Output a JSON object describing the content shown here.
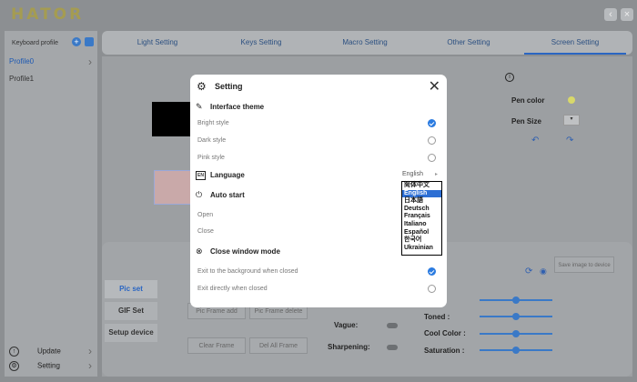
{
  "app": {
    "logo": "HATOR",
    "minimize_label": "‹",
    "close_label": "×"
  },
  "sidebar": {
    "header": "Keyboard profile",
    "add_label": "+",
    "profiles": [
      {
        "label": "Profile0",
        "active": true
      },
      {
        "label": "Profile1",
        "active": false
      }
    ],
    "footer": [
      {
        "label": "Update",
        "icon": "↑"
      },
      {
        "label": "Setting",
        "icon": "⚙"
      }
    ]
  },
  "tabs": [
    {
      "label": "Light Setting",
      "active": false
    },
    {
      "label": "Keys Setting",
      "active": false
    },
    {
      "label": "Macro Setting",
      "active": false
    },
    {
      "label": "Other Setting",
      "active": false
    },
    {
      "label": "Screen Setting",
      "active": true
    }
  ],
  "screen": {
    "pen_color_label": "Pen color",
    "pen_size_label": "Pen Size",
    "pen_color": "#d8d86a",
    "info_label": "i"
  },
  "bottom": {
    "side_tabs": [
      {
        "label": "Pic set",
        "active": true
      },
      {
        "label": "GIF Set",
        "active": false
      },
      {
        "label": "Setup device",
        "active": false
      }
    ],
    "buttons": {
      "pic_frame_add": "Pic Frame add",
      "pic_frame_delete": "Pic Frame delete",
      "clear_frame": "Clear Frame",
      "del_all_frame": "Del All Frame",
      "save_image": "Save image to device"
    },
    "adjust": {
      "vague": "Vague:",
      "sharpening": "Sharpening:",
      "toned": "Toned :",
      "cool_color": "Cool Color :",
      "saturation": "Saturation :"
    }
  },
  "modal": {
    "title": "Setting",
    "close_label": "✕",
    "theme": {
      "heading": "Interface theme",
      "options": [
        {
          "label": "Bright style",
          "selected": true
        },
        {
          "label": "Dark style",
          "selected": false
        },
        {
          "label": "Pink style",
          "selected": false
        }
      ]
    },
    "language": {
      "heading": "Language",
      "badge": "EN",
      "current": "English",
      "options": [
        {
          "label": "简体中文",
          "selected": false
        },
        {
          "label": "English",
          "selected": true
        },
        {
          "label": "日本語",
          "selected": false
        },
        {
          "label": "Deutsch",
          "selected": false
        },
        {
          "label": "Français",
          "selected": false
        },
        {
          "label": "Italiano",
          "selected": false
        },
        {
          "label": "Español",
          "selected": false
        },
        {
          "label": "한국어",
          "selected": false
        },
        {
          "label": "Ukrainian",
          "selected": false
        }
      ]
    },
    "auto_start": {
      "heading": "Auto start",
      "options": [
        {
          "label": "Open"
        },
        {
          "label": "Close"
        }
      ]
    },
    "close_mode": {
      "heading": "Close window mode",
      "options": [
        {
          "label": "Exit to the background when closed",
          "selected": true
        },
        {
          "label": "Exit directly when closed",
          "selected": false
        }
      ]
    }
  }
}
